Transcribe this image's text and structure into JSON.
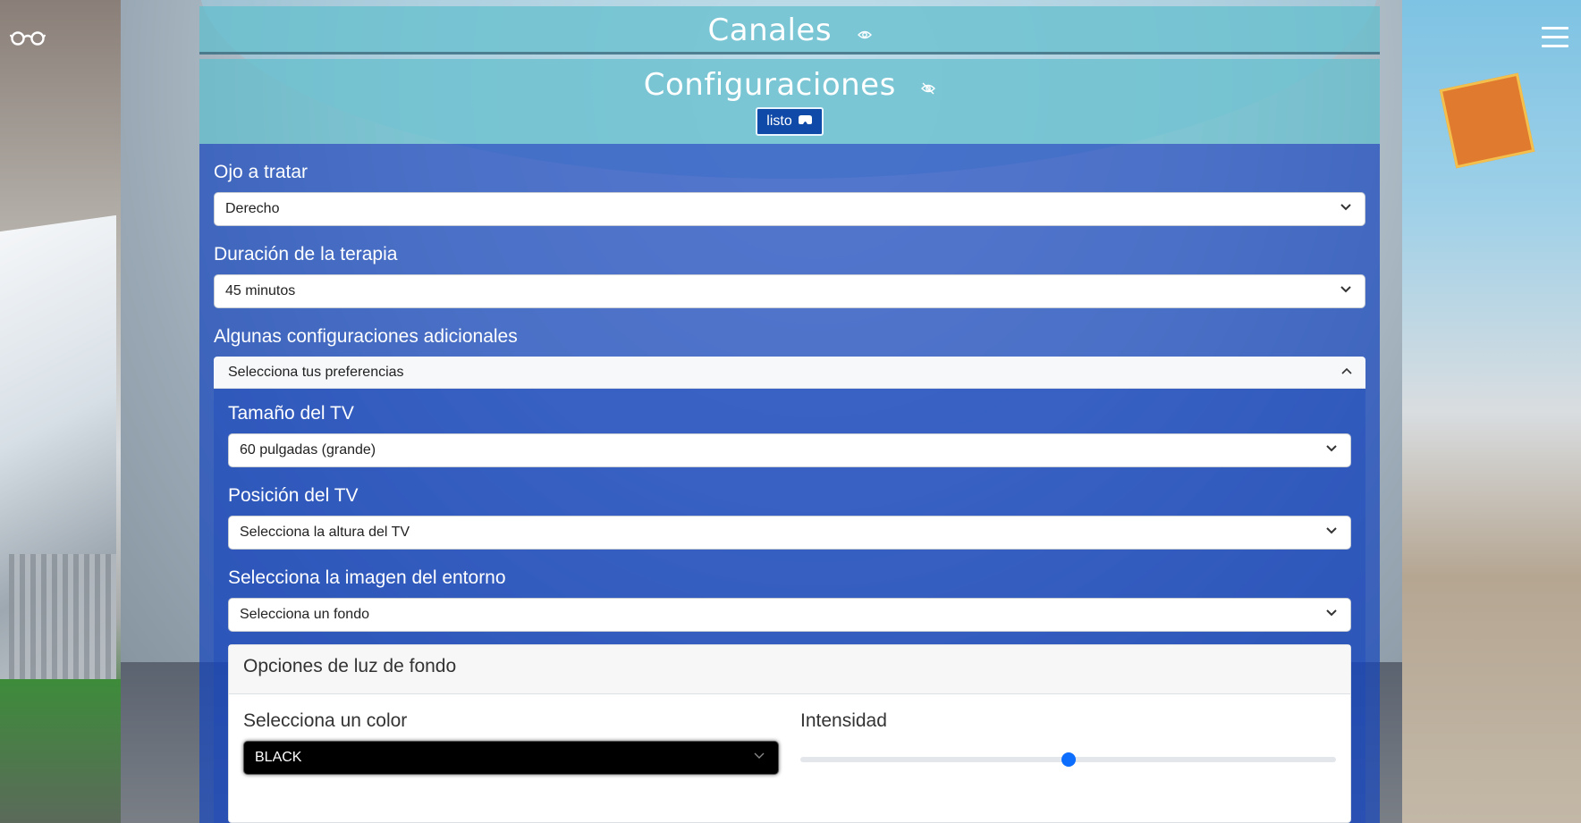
{
  "header": {
    "channels_title": "Canales",
    "config_title": "Configuraciones",
    "done_button": "listo",
    "done_icon": "vr-headset-icon"
  },
  "corner": {
    "left_icon": "glasses-icon",
    "right_icon": "hamburger-menu-icon"
  },
  "form": {
    "eye_label": "Ojo a tratar",
    "eye_value": "Derecho",
    "duration_label": "Duración de la terapia",
    "duration_value": "45 minutos",
    "extra_label": "Algunas configuraciones adicionales",
    "accordion_title": "Selecciona tus preferencias",
    "tv_size_label": "Tamaño del TV",
    "tv_size_value": "60 pulgadas (grande)",
    "tv_position_label": "Posición del TV",
    "tv_position_value": "Selecciona la altura del TV",
    "environment_label": "Selecciona la imagen del entorno",
    "environment_value": "Selecciona un fondo",
    "backlight_title": "Opciones de luz de fondo",
    "color_label": "Selecciona un color",
    "color_value": "BLACK",
    "intensity_label": "Intensidad",
    "intensity_value": 0.5
  },
  "colors": {
    "accent": "#0d6efd",
    "teal_bar": "#61becd",
    "blue_overlay": "#1646be"
  }
}
